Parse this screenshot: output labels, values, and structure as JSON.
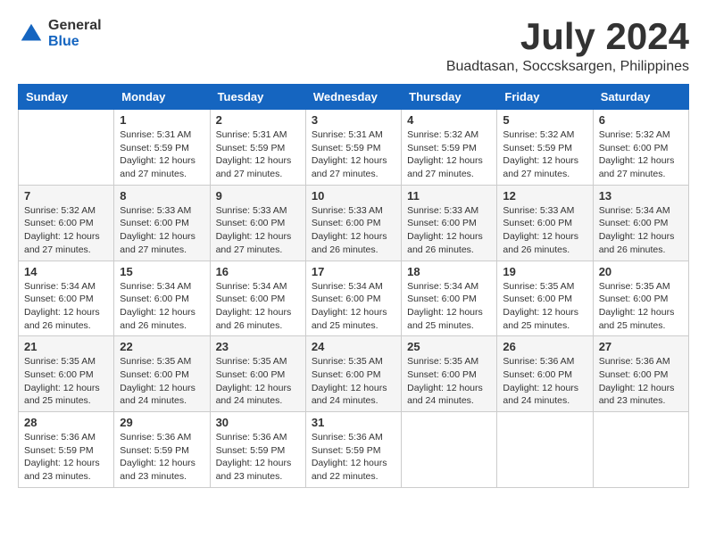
{
  "logo": {
    "general": "General",
    "blue": "Blue"
  },
  "title": {
    "month_year": "July 2024",
    "location": "Buadtasan, Soccsksargen, Philippines"
  },
  "days_of_week": [
    "Sunday",
    "Monday",
    "Tuesday",
    "Wednesday",
    "Thursday",
    "Friday",
    "Saturday"
  ],
  "weeks": [
    [
      {
        "day": "",
        "info": ""
      },
      {
        "day": "1",
        "info": "Sunrise: 5:31 AM\nSunset: 5:59 PM\nDaylight: 12 hours\nand 27 minutes."
      },
      {
        "day": "2",
        "info": "Sunrise: 5:31 AM\nSunset: 5:59 PM\nDaylight: 12 hours\nand 27 minutes."
      },
      {
        "day": "3",
        "info": "Sunrise: 5:31 AM\nSunset: 5:59 PM\nDaylight: 12 hours\nand 27 minutes."
      },
      {
        "day": "4",
        "info": "Sunrise: 5:32 AM\nSunset: 5:59 PM\nDaylight: 12 hours\nand 27 minutes."
      },
      {
        "day": "5",
        "info": "Sunrise: 5:32 AM\nSunset: 5:59 PM\nDaylight: 12 hours\nand 27 minutes."
      },
      {
        "day": "6",
        "info": "Sunrise: 5:32 AM\nSunset: 6:00 PM\nDaylight: 12 hours\nand 27 minutes."
      }
    ],
    [
      {
        "day": "7",
        "info": "Sunrise: 5:32 AM\nSunset: 6:00 PM\nDaylight: 12 hours\nand 27 minutes."
      },
      {
        "day": "8",
        "info": "Sunrise: 5:33 AM\nSunset: 6:00 PM\nDaylight: 12 hours\nand 27 minutes."
      },
      {
        "day": "9",
        "info": "Sunrise: 5:33 AM\nSunset: 6:00 PM\nDaylight: 12 hours\nand 27 minutes."
      },
      {
        "day": "10",
        "info": "Sunrise: 5:33 AM\nSunset: 6:00 PM\nDaylight: 12 hours\nand 26 minutes."
      },
      {
        "day": "11",
        "info": "Sunrise: 5:33 AM\nSunset: 6:00 PM\nDaylight: 12 hours\nand 26 minutes."
      },
      {
        "day": "12",
        "info": "Sunrise: 5:33 AM\nSunset: 6:00 PM\nDaylight: 12 hours\nand 26 minutes."
      },
      {
        "day": "13",
        "info": "Sunrise: 5:34 AM\nSunset: 6:00 PM\nDaylight: 12 hours\nand 26 minutes."
      }
    ],
    [
      {
        "day": "14",
        "info": "Sunrise: 5:34 AM\nSunset: 6:00 PM\nDaylight: 12 hours\nand 26 minutes."
      },
      {
        "day": "15",
        "info": "Sunrise: 5:34 AM\nSunset: 6:00 PM\nDaylight: 12 hours\nand 26 minutes."
      },
      {
        "day": "16",
        "info": "Sunrise: 5:34 AM\nSunset: 6:00 PM\nDaylight: 12 hours\nand 26 minutes."
      },
      {
        "day": "17",
        "info": "Sunrise: 5:34 AM\nSunset: 6:00 PM\nDaylight: 12 hours\nand 25 minutes."
      },
      {
        "day": "18",
        "info": "Sunrise: 5:34 AM\nSunset: 6:00 PM\nDaylight: 12 hours\nand 25 minutes."
      },
      {
        "day": "19",
        "info": "Sunrise: 5:35 AM\nSunset: 6:00 PM\nDaylight: 12 hours\nand 25 minutes."
      },
      {
        "day": "20",
        "info": "Sunrise: 5:35 AM\nSunset: 6:00 PM\nDaylight: 12 hours\nand 25 minutes."
      }
    ],
    [
      {
        "day": "21",
        "info": "Sunrise: 5:35 AM\nSunset: 6:00 PM\nDaylight: 12 hours\nand 25 minutes."
      },
      {
        "day": "22",
        "info": "Sunrise: 5:35 AM\nSunset: 6:00 PM\nDaylight: 12 hours\nand 24 minutes."
      },
      {
        "day": "23",
        "info": "Sunrise: 5:35 AM\nSunset: 6:00 PM\nDaylight: 12 hours\nand 24 minutes."
      },
      {
        "day": "24",
        "info": "Sunrise: 5:35 AM\nSunset: 6:00 PM\nDaylight: 12 hours\nand 24 minutes."
      },
      {
        "day": "25",
        "info": "Sunrise: 5:35 AM\nSunset: 6:00 PM\nDaylight: 12 hours\nand 24 minutes."
      },
      {
        "day": "26",
        "info": "Sunrise: 5:36 AM\nSunset: 6:00 PM\nDaylight: 12 hours\nand 24 minutes."
      },
      {
        "day": "27",
        "info": "Sunrise: 5:36 AM\nSunset: 6:00 PM\nDaylight: 12 hours\nand 23 minutes."
      }
    ],
    [
      {
        "day": "28",
        "info": "Sunrise: 5:36 AM\nSunset: 5:59 PM\nDaylight: 12 hours\nand 23 minutes."
      },
      {
        "day": "29",
        "info": "Sunrise: 5:36 AM\nSunset: 5:59 PM\nDaylight: 12 hours\nand 23 minutes."
      },
      {
        "day": "30",
        "info": "Sunrise: 5:36 AM\nSunset: 5:59 PM\nDaylight: 12 hours\nand 23 minutes."
      },
      {
        "day": "31",
        "info": "Sunrise: 5:36 AM\nSunset: 5:59 PM\nDaylight: 12 hours\nand 22 minutes."
      },
      {
        "day": "",
        "info": ""
      },
      {
        "day": "",
        "info": ""
      },
      {
        "day": "",
        "info": ""
      }
    ]
  ]
}
